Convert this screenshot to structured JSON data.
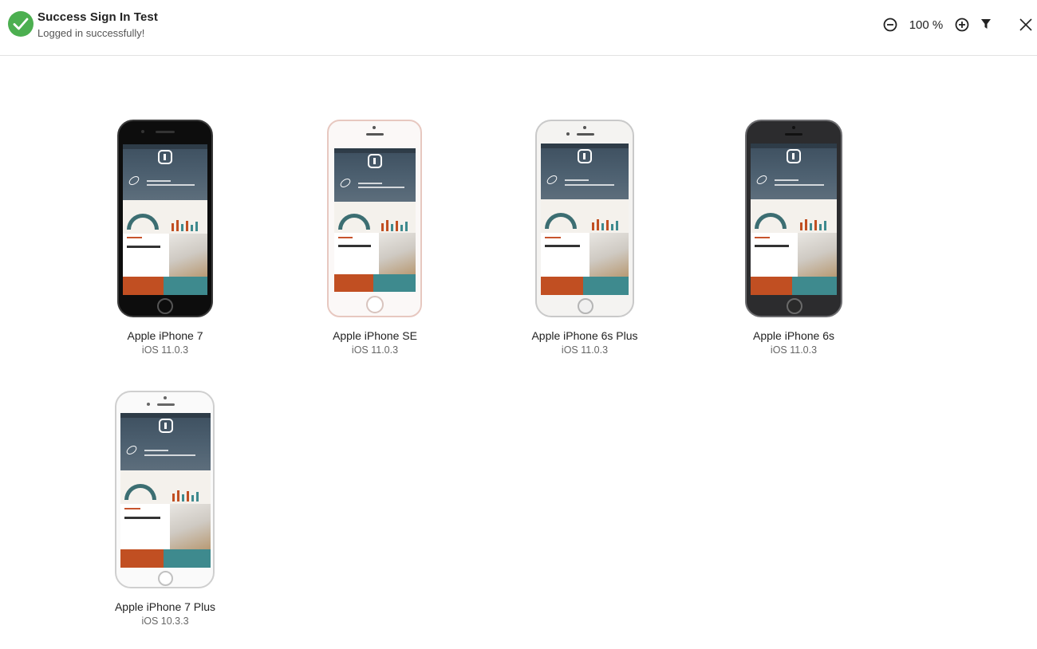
{
  "header": {
    "title": "Success Sign In Test",
    "subtitle": "Logged in successfully!",
    "status_icon": "checkmark-icon",
    "status_color": "#4caf50"
  },
  "toolbar": {
    "zoom_out_icon": "minus-circle-icon",
    "zoom_level": "100 %",
    "zoom_in_icon": "plus-circle-icon",
    "filter_icon": "filter-icon",
    "close_icon": "close-icon"
  },
  "devices": [
    {
      "name": "Apple iPhone 7",
      "os": "iOS 11.0.3",
      "finish": "black"
    },
    {
      "name": "Apple iPhone SE",
      "os": "iOS 11.0.3",
      "finish": "rose gold"
    },
    {
      "name": "Apple iPhone 6s Plus",
      "os": "iOS 11.0.3",
      "finish": "silver"
    },
    {
      "name": "Apple iPhone 6s",
      "os": "iOS 11.0.3",
      "finish": "space gray"
    },
    {
      "name": "Apple iPhone 7 Plus",
      "os": "iOS 10.3.3",
      "finish": "silver"
    }
  ],
  "colors": {
    "accent_orange": "#c14f22",
    "accent_teal": "#3e8a8e",
    "success_green": "#4caf50"
  }
}
